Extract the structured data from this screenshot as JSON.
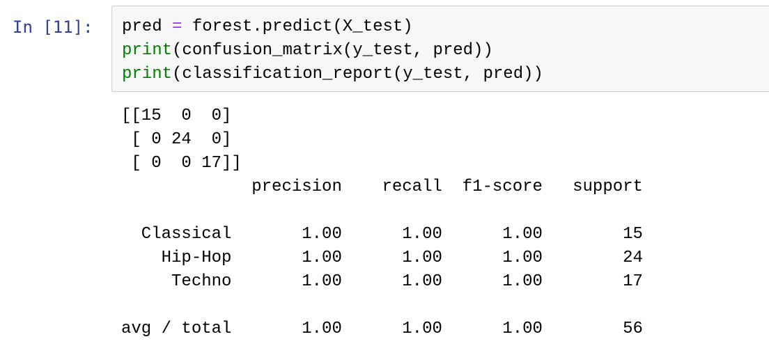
{
  "cell": {
    "prompt": "In [11]:",
    "code_lines": [
      [
        {
          "text": "pred ",
          "kind": "plain"
        },
        {
          "text": "=",
          "kind": "op"
        },
        {
          "text": " forest.predict(X_test)",
          "kind": "plain"
        }
      ],
      [
        {
          "text": "print",
          "kind": "builtin"
        },
        {
          "text": "(confusion_matrix(y_test, pred))",
          "kind": "plain"
        }
      ],
      [
        {
          "text": "print",
          "kind": "builtin"
        },
        {
          "text": "(classification_report(y_test, pred))",
          "kind": "plain"
        }
      ]
    ],
    "output_lines": [
      "[[15  0  0]",
      " [ 0 24  0]",
      " [ 0  0 17]]",
      "             precision    recall  f1-score   support",
      "",
      "  Classical       1.00      1.00      1.00        15",
      "    Hip-Hop       1.00      1.00      1.00        24",
      "     Techno       1.00      1.00      1.00        17",
      "",
      "avg / total       1.00      1.00      1.00        56"
    ]
  },
  "colors": {
    "prompt": "#303f9f",
    "operator": "#aa22ff",
    "builtin": "#008000",
    "input_background": "#f7f7f7",
    "input_border": "#cfcfcf"
  }
}
